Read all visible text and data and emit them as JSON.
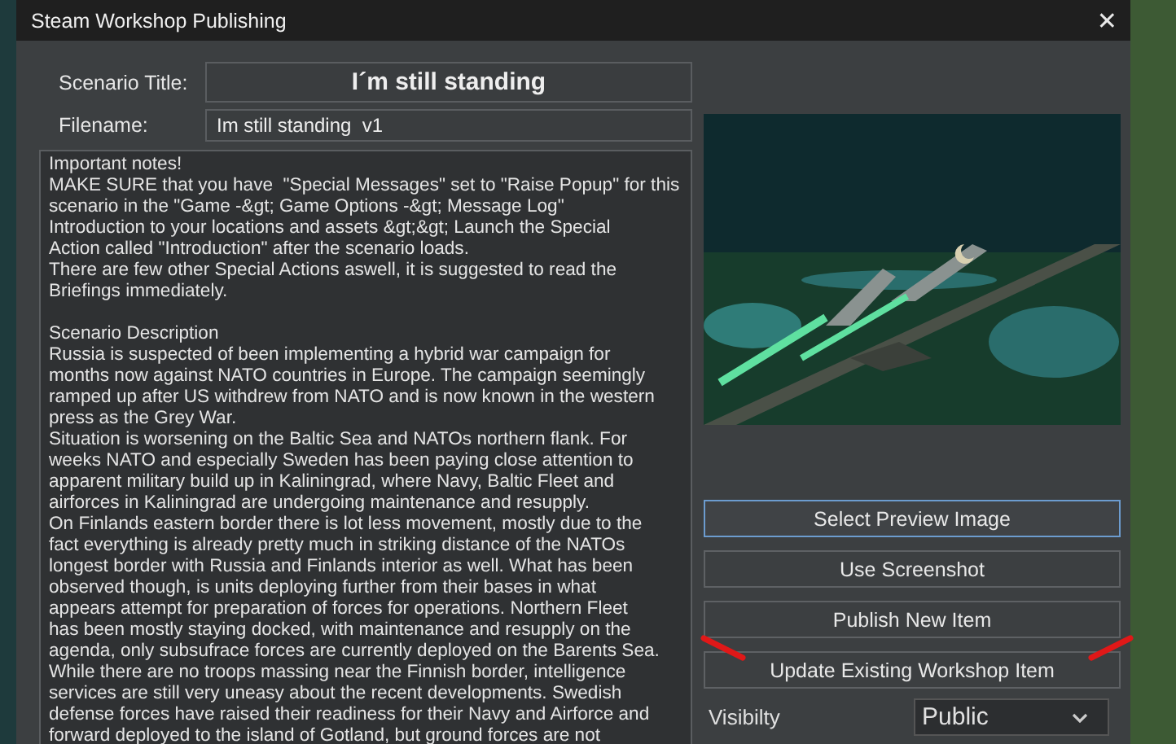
{
  "window": {
    "title": "Steam Workshop Publishing",
    "close": "✕"
  },
  "fields": [
    {
      "label": "Scenario Title:",
      "value": "I´m still standing",
      "kind": "title"
    },
    {
      "label": "Filename:",
      "value": "Im still standing  v1",
      "kind": "plain"
    }
  ],
  "description": "Important notes!\nMAKE SURE that you have  \"Special Messages\" set to \"Raise Popup\" for this\nscenario in the \"Game -&gt; Game Options -&gt; Message Log\"\nIntroduction to your locations and assets &gt;&gt; Launch the Special\nAction called \"Introduction\" after the scenario loads.\nThere are few other Special Actions aswell, it is suggested to read the\nBriefings immediately.\n\nScenario Description\nRussia is suspected of been implementing a hybrid war campaign for\nmonths now against NATO countries in Europe. The campaign seemingly\nramped up after US withdrew from NATO and is now known in the western\npress as the Grey War.\nSituation is worsening on the Baltic Sea and NATOs northern flank. For\nweeks NATO and especially Sweden has been paying close attention to\napparent military build up in Kaliningrad, where Navy, Baltic Fleet and\nairforces in Kaliningrad are undergoing maintenance and resupply.\nOn Finlands eastern border there is lot less movement, mostly due to the\nfact everything is already pretty much in striking distance of the NATOs\nlongest border with Russia and Finlands interior as well. What has been\nobserved though, is units deploying further from their bases in what\nappears attempt for preparation of forces for operations. Northern Fleet\nhas been mostly staying docked, with maintenance and resupply on the\nagenda, only subsufrace forces are currently deployed on the Barents Sea.\nWhile there are no troops massing near the Finnish border, intelligence\nservices are still very uneasy about the recent developments. Swedish\ndefense forces have raised their readiness for their Navy and Airforce and\nforward deployed to the island of Gotland, but ground forces are not",
  "buttons": [
    {
      "label": "Select Preview Image",
      "focused": true,
      "marked": false
    },
    {
      "label": "Use Screenshot",
      "focused": false,
      "marked": false
    },
    {
      "label": "Publish New Item",
      "focused": false,
      "marked": false
    },
    {
      "label": "Update Existing Workshop Item",
      "focused": false,
      "marked": true
    }
  ],
  "visibility": {
    "label": "Visibilty",
    "value": "Public"
  }
}
